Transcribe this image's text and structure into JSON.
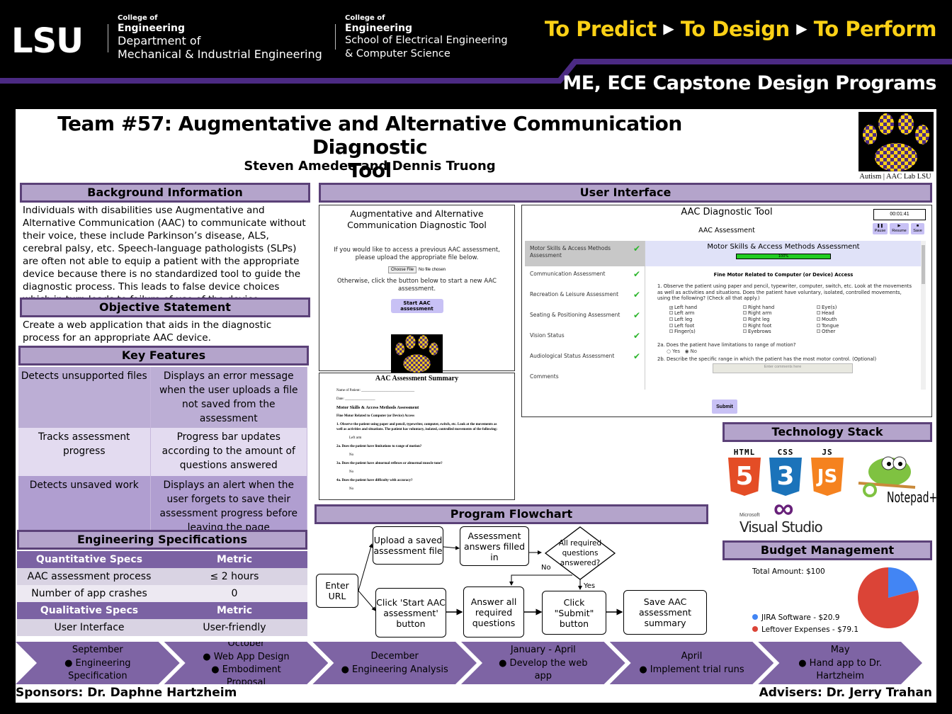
{
  "header": {
    "logo": "LSU",
    "college_1": {
      "small": "College of",
      "eng": "Engineering",
      "line1": "Department of",
      "line2": "Mechanical & Industrial Engineering"
    },
    "college_2": {
      "small": "College of",
      "eng": "Engineering",
      "line1": "School of Electrical Engineering",
      "line2": "& Computer Science"
    },
    "tagline": [
      "To Predict",
      "To Design",
      "To Perform"
    ],
    "subtitle": "ME, ECE Capstone Design Programs"
  },
  "poster": {
    "title_line1": "Team #57: Augmentative and Alternative Communication Diagnostic",
    "title_line2": "Tool",
    "authors": "Steven Amedee and Dennis Truong",
    "logo_caption": "Autism | AAC Lab LSU"
  },
  "background": {
    "heading": "Background Information",
    "text": "Individuals with disabilities use Augmentative and Alternative Communication (AAC) to communicate without their voice, these include Parkinson’s disease, ALS, cerebral palsy, etc. Speech-language pathologists (SLPs) are often not able to equip a patient with the appropriate device because there is no standardized tool to guide the diagnostic process. This leads to false device choices which in turn leads to failure of use of the device."
  },
  "objective": {
    "heading": "Objective Statement",
    "text": "Create a web application that aids in the diagnostic process for an appropriate AAC device."
  },
  "key_features": {
    "heading": "Key Features",
    "rows": [
      {
        "feature": "Detects unsupported files",
        "description": "Displays an error message when the user uploads a file not saved from the assessment"
      },
      {
        "feature": "Tracks assessment progress",
        "description": "Progress bar updates according to the amount of questions answered"
      },
      {
        "feature": "Detects unsaved work",
        "description": "Displays an alert when the user forgets to save their assessment progress before leaving the page"
      }
    ]
  },
  "eng_specs": {
    "heading": "Engineering Specifications",
    "quant_header": [
      "Quantitative Specs",
      "Metric"
    ],
    "quant_rows": [
      [
        "AAC assessment process",
        "≤ 2 hours"
      ],
      [
        "Number of app crashes",
        "0"
      ]
    ],
    "qual_header": [
      "Qualitative Specs",
      "Metric"
    ],
    "qual_rows": [
      [
        "User Interface",
        "User-friendly"
      ]
    ]
  },
  "ui": {
    "heading": "User Interface",
    "start_screen": {
      "title": "Augmentative and Alternative Communication Diagnostic Tool",
      "upload_prompt_1": "If you would like to access a previous AAC assessment,",
      "upload_prompt_2": "please upload the appropriate file below.",
      "choose_file": "Choose File",
      "no_file": "No file chosen",
      "otherwise": "Otherwise, click the button below to start a new AAC assessment.",
      "start_button": "Start AAC assessment",
      "logo_caption": "Autism | AAC Lab LSU"
    },
    "summary": {
      "title": "AAC Assessment Summary",
      "lines": [
        {
          "text": "Name of Patient: ______________________________",
          "style": ""
        },
        {
          "text": "Date: _________________",
          "style": ""
        },
        {
          "text": "Motor Skills & Access Methods Assessment",
          "style": "h"
        },
        {
          "text": "Fine Motor Related to Computer (or Device) Access",
          "style": "b"
        },
        {
          "text": "1. Observe the patient using paper and pencil, typewriter, computer, switch, etc. Look at the movements as well as activities and situations. The patient has voluntary, isolated, controlled movements of the following:",
          "style": "b"
        },
        {
          "text": "Left arm",
          "style": "ind"
        },
        {
          "text": "2a. Does the patient have limitations to range of motion?",
          "style": "b"
        },
        {
          "text": "No",
          "style": "ind"
        },
        {
          "text": "3a. Does the patient have abnormal reflexes or abnormal muscle tone?",
          "style": "b"
        },
        {
          "text": "No",
          "style": "ind"
        },
        {
          "text": "4a. Does the patient have difficulty with accuracy?",
          "style": "b"
        },
        {
          "text": "No",
          "style": "ind"
        }
      ]
    },
    "tool": {
      "title": "AAC Diagnostic Tool",
      "subtitle": "AAC Assessment",
      "timer": "00:01:41",
      "controls": [
        "Pause",
        "Resume",
        "Save"
      ],
      "sections": [
        {
          "label": "Motor Skills & Access Methods Assessment",
          "done": true
        },
        {
          "label": "Communication Assessment",
          "done": true
        },
        {
          "label": "Recreation & Leisure Assessment",
          "done": true
        },
        {
          "label": "Seating & Positioning Assessment",
          "done": true
        },
        {
          "label": "Vision Status",
          "done": true
        },
        {
          "label": "Audiological Status Assessment",
          "done": true
        },
        {
          "label": "Comments",
          "done": false
        }
      ],
      "active_section": "Motor Skills & Access Methods Assessment",
      "progress_percent": 100,
      "progress_label": "100%",
      "subsection": "Fine Motor Related to Computer (or Device) Access",
      "q1": "1. Observe the patient using paper and pencil, typewriter, computer, switch, etc. Look at the movements as well as activities and situations. Does the patient have voluntary, isolated, controlled movements, using the following? (Check all that apply.)",
      "checkboxes": [
        {
          "label": "Left hand",
          "checked": true
        },
        {
          "label": "Right hand",
          "checked": false
        },
        {
          "label": "Eye(s)",
          "checked": false
        },
        {
          "label": "Left arm",
          "checked": false
        },
        {
          "label": "Right arm",
          "checked": false
        },
        {
          "label": "Head",
          "checked": false
        },
        {
          "label": "Left leg",
          "checked": false
        },
        {
          "label": "Right leg",
          "checked": false
        },
        {
          "label": "Mouth",
          "checked": false
        },
        {
          "label": "Left foot",
          "checked": false
        },
        {
          "label": "Right foot",
          "checked": false
        },
        {
          "label": "Tongue",
          "checked": false
        },
        {
          "label": "Finger(s)",
          "checked": false
        },
        {
          "label": "Eyebrows",
          "checked": false
        },
        {
          "label": "Other",
          "checked": false
        }
      ],
      "q2a": "2a. Does the patient have limitations to range of motion?",
      "q2a_options": [
        "Yes",
        "No"
      ],
      "q2a_selected": "No",
      "q2b": "2b. Describe the specific range in which the patient has the most motor control. (Optional)",
      "comment_placeholder": "Enter comments here",
      "submit": "Submit"
    }
  },
  "flowchart": {
    "heading": "Program Flowchart",
    "nodes": {
      "enter_url": "Enter URL",
      "upload": "Upload a saved assessment file",
      "filled": "Assessment answers filled in",
      "decision": "All required questions answered?",
      "start": "Click 'Start AAC assessment' button",
      "answer": "Answer all required questions",
      "submit": "Click \"Submit\" button",
      "save": "Save AAC assessment summary"
    },
    "labels": {
      "no": "No",
      "yes": "Yes"
    }
  },
  "tech_stack": {
    "heading": "Technology Stack",
    "items": [
      {
        "name": "HTML",
        "glyph": "5",
        "color": "#e44d26"
      },
      {
        "name": "CSS",
        "glyph": "3",
        "color": "#1b73ba"
      },
      {
        "name": "JS",
        "glyph": "JS",
        "color": "#f5821f"
      },
      {
        "name": "Notepad++",
        "glyph": "Notepad++",
        "color": "#7fc241"
      },
      {
        "name": "Visual Studio",
        "brand": "Microsoft",
        "glyph": "∞",
        "color": "#68217a"
      }
    ]
  },
  "budget": {
    "heading": "Budget Management",
    "total": "Total Amount: $100"
  },
  "chart_data": {
    "type": "pie",
    "title": "Total Amount: $100",
    "categories": [
      "JIRA Software",
      "Leftover Expenses"
    ],
    "values": [
      20.9,
      79.1
    ],
    "labels": [
      "JIRA Software - $20.9",
      "Leftover Expenses - $79.1"
    ],
    "colors": [
      "#4285f4",
      "#db4437"
    ],
    "legend": "bottom-left",
    "start_angle_deg": 0,
    "direction": "clockwise"
  },
  "timeline": [
    {
      "month": "September",
      "items": [
        "● Engineering Specification"
      ]
    },
    {
      "month": "October",
      "items": [
        "● Web App Design",
        "● Embodiment Proposal"
      ]
    },
    {
      "month": "December",
      "items": [
        "● Engineering Analysis"
      ]
    },
    {
      "month": "January - April",
      "items": [
        "● Develop the web app"
      ]
    },
    {
      "month": "April",
      "items": [
        "● Implement trial runs"
      ]
    },
    {
      "month": "May",
      "items": [
        "● Hand app to Dr. Hartzheim"
      ]
    }
  ],
  "footer": {
    "sponsors": "Sponsors: Dr. Daphne Hartzheim",
    "advisers": "Advisers: Dr. Jerry Trahan"
  }
}
